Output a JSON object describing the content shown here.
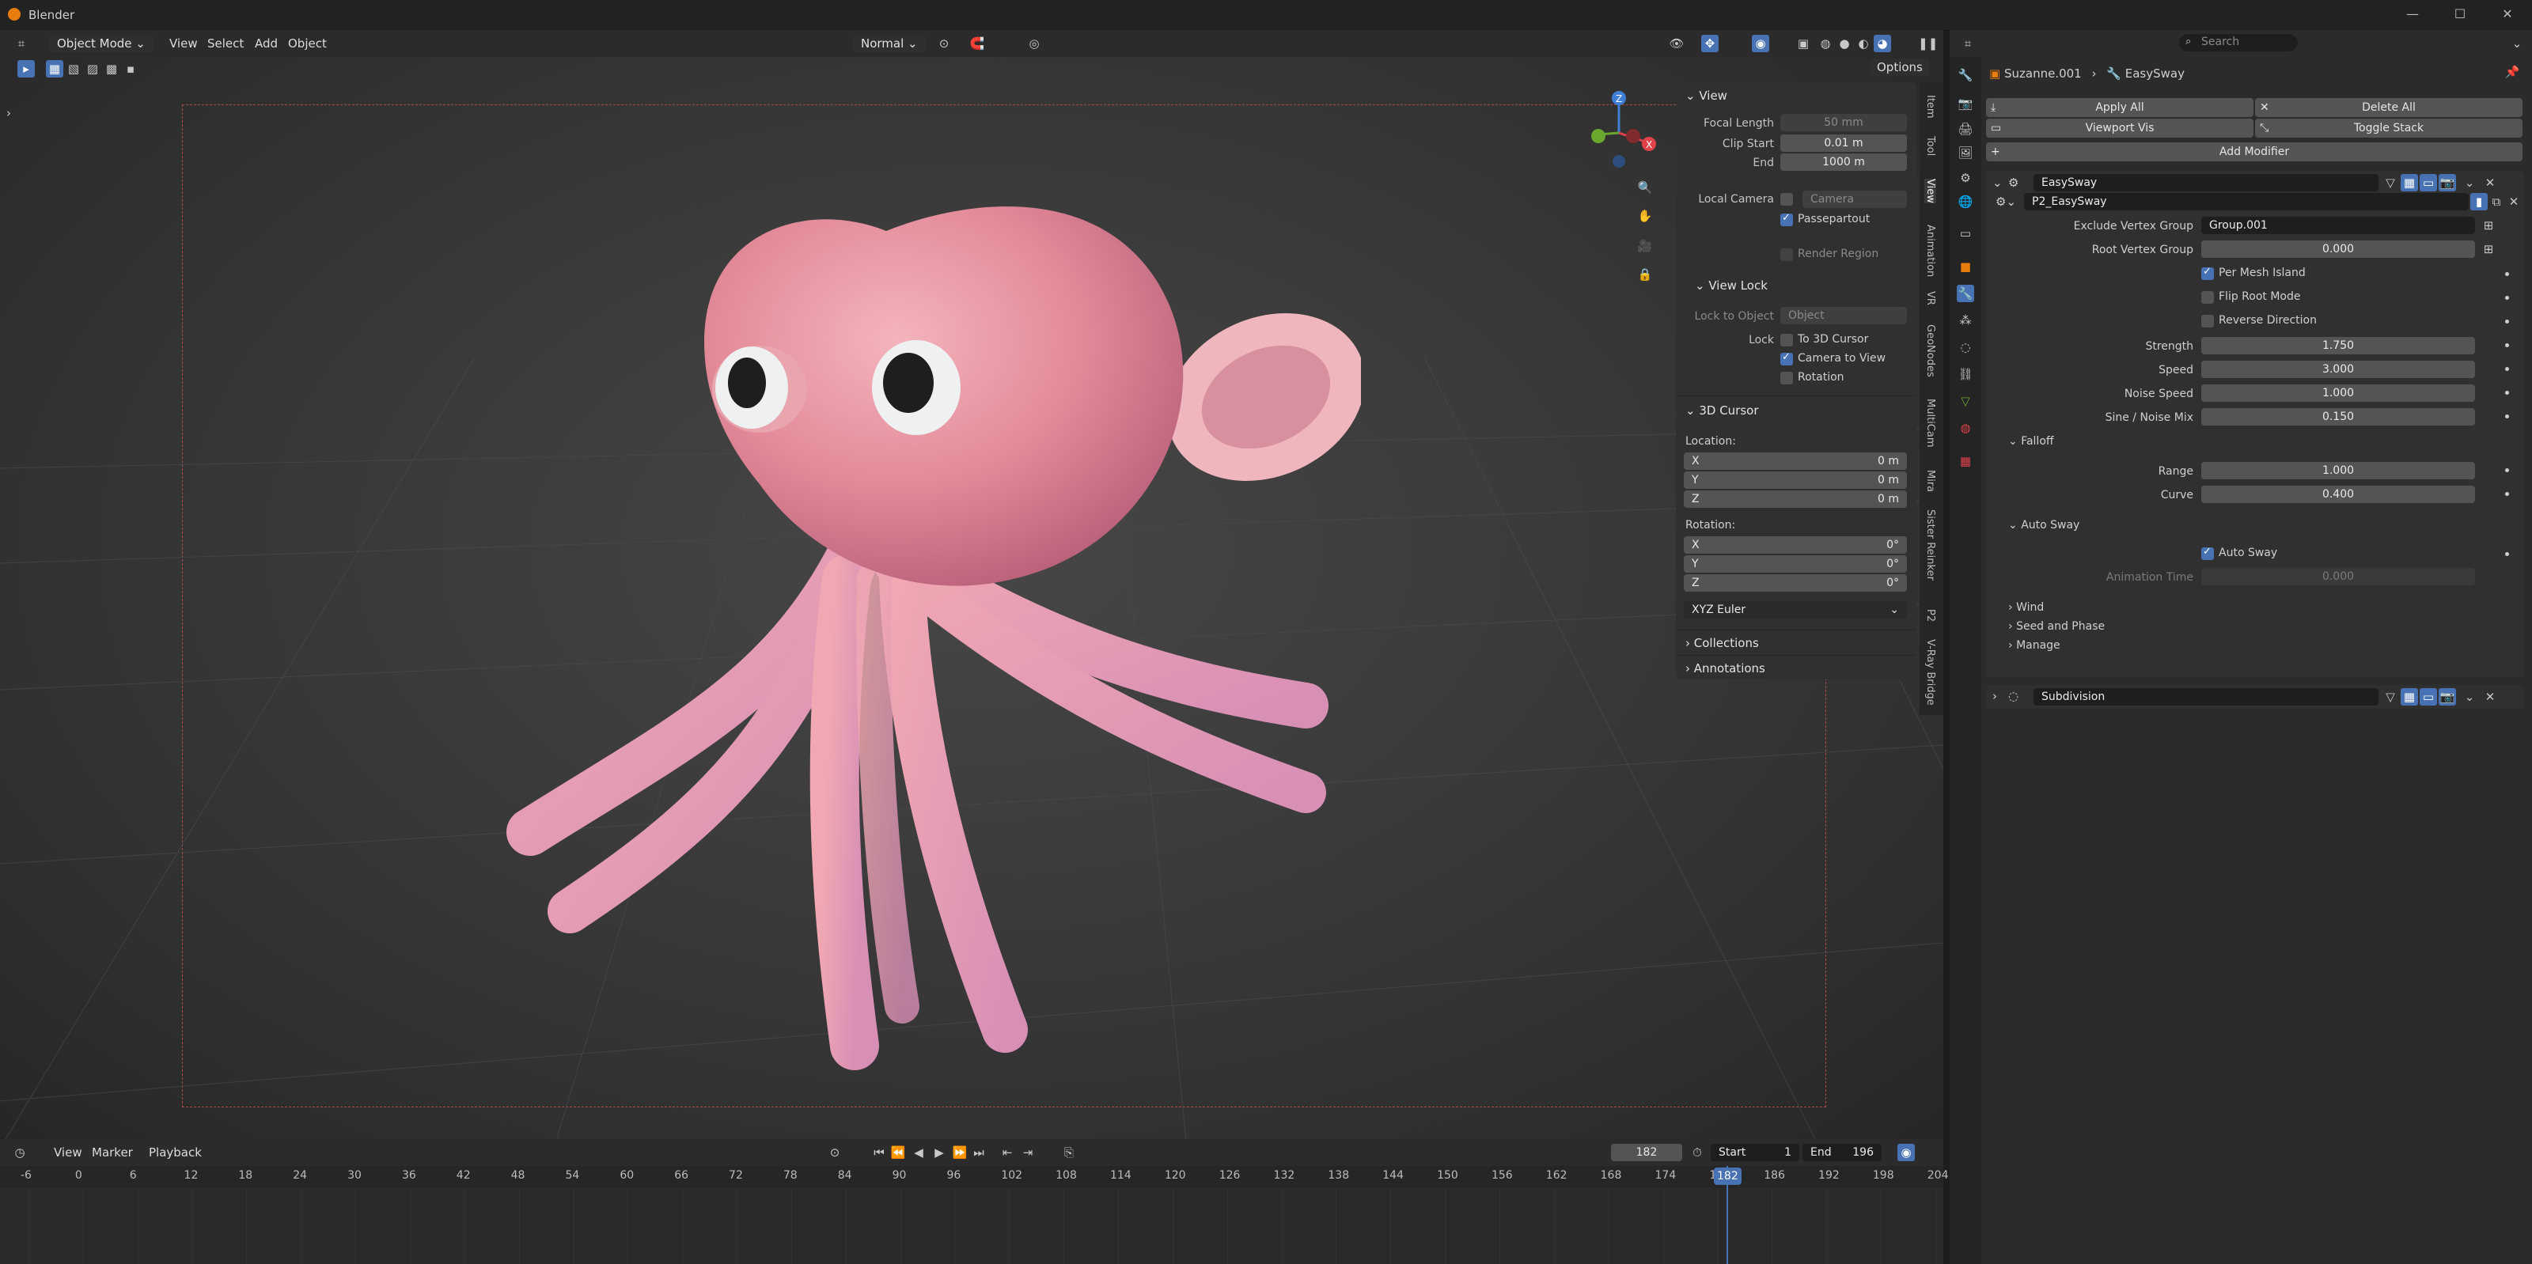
{
  "window": {
    "title": "Blender"
  },
  "header3d": {
    "mode": "Object Mode",
    "menus": [
      "View",
      "Select",
      "Add",
      "Object"
    ],
    "orientation": "Normal",
    "options_label": "Options"
  },
  "npanel": {
    "view_title": "View",
    "focal_length_label": "Focal Length",
    "focal_length": "50 mm",
    "clip_start_label": "Clip Start",
    "clip_start": "0.01 m",
    "end_label": "End",
    "end": "1000 m",
    "local_camera_label": "Local Camera",
    "camera_placeholder": "Camera",
    "passepartout_label": "Passepartout",
    "passepartout_checked": true,
    "render_region_label": "Render Region",
    "view_lock_title": "View Lock",
    "lock_to_object_label": "Lock to Object",
    "object_placeholder": "Object",
    "lock_label": "Lock",
    "to_cursor_label": "To 3D Cursor",
    "camera_to_view_label": "Camera to View",
    "rotation_lock_label": "Rotation",
    "cursor_title": "3D Cursor",
    "location_label": "Location:",
    "loc_x_label": "X",
    "loc_x": "0 m",
    "loc_y_label": "Y",
    "loc_y": "0 m",
    "loc_z_label": "Z",
    "loc_z": "0 m",
    "rotation_label": "Rotation:",
    "rot_x_label": "X",
    "rot_x": "0°",
    "rot_y_label": "Y",
    "rot_y": "0°",
    "rot_z_label": "Z",
    "rot_z": "0°",
    "rotation_mode": "XYZ Euler",
    "collections_title": "Collections",
    "annotations_title": "Annotations"
  },
  "side_tabs": [
    "Item",
    "Tool",
    "View",
    "Animation",
    "VR",
    "GeoNodes",
    "MultiCam",
    "Mira",
    "Sister Reinker",
    "P2",
    "V-Ray Bridge"
  ],
  "properties": {
    "search_placeholder": "Search",
    "breadcrumb_object": "Suzanne.001",
    "breadcrumb_modifier": "EasySway",
    "apply_all": "Apply All",
    "delete_all": "Delete All",
    "viewport_vis": "Viewport Vis",
    "toggle_stack": "Toggle Stack",
    "add_modifier": "Add Modifier",
    "modifier_name": "EasySway",
    "node_group": "P2_EasySway",
    "exclude_vg_label": "Exclude Vertex Group",
    "exclude_vg": "Group.001",
    "root_vg_label": "Root Vertex Group",
    "root_vg": "0.000",
    "per_mesh_island": "Per Mesh Island",
    "flip_root_mode": "Flip Root Mode",
    "reverse_direction": "Reverse Direction",
    "strength_label": "Strength",
    "strength": "1.750",
    "speed_label": "Speed",
    "speed": "3.000",
    "noise_speed_label": "Noise Speed",
    "noise_speed": "1.000",
    "sine_noise_label": "Sine / Noise Mix",
    "sine_noise": "0.150",
    "falloff_title": "Falloff",
    "range_label": "Range",
    "range": "1.000",
    "curve_label": "Curve",
    "curve": "0.400",
    "auto_sway_title": "Auto Sway",
    "auto_sway_check": "Auto Sway",
    "animation_time_label": "Animation Time",
    "animation_time": "0.000",
    "wind_title": "Wind",
    "seed_title": "Seed and Phase",
    "manage_title": "Manage",
    "subdivision_name": "Subdivision"
  },
  "timeline": {
    "menus": [
      "View",
      "Marker",
      "Playback"
    ],
    "current_frame": "182",
    "start_label": "Start",
    "start": "1",
    "end_label": "End",
    "end": "196",
    "ticks": [
      "-6",
      "0",
      "6",
      "12",
      "18",
      "24",
      "30",
      "36",
      "42",
      "48",
      "54",
      "60",
      "66",
      "72",
      "78",
      "84",
      "90",
      "96",
      "102",
      "108",
      "114",
      "120",
      "126",
      "132",
      "138",
      "144",
      "150",
      "156",
      "162",
      "168",
      "174",
      "18",
      "186",
      "192",
      "198",
      "204"
    ],
    "playhead_frame": "182"
  },
  "colors": {
    "accent": "#4772b3",
    "gizmo_x": "#e0424a",
    "gizmo_y": "#6aa830",
    "gizmo_z": "#3f7fd6"
  }
}
